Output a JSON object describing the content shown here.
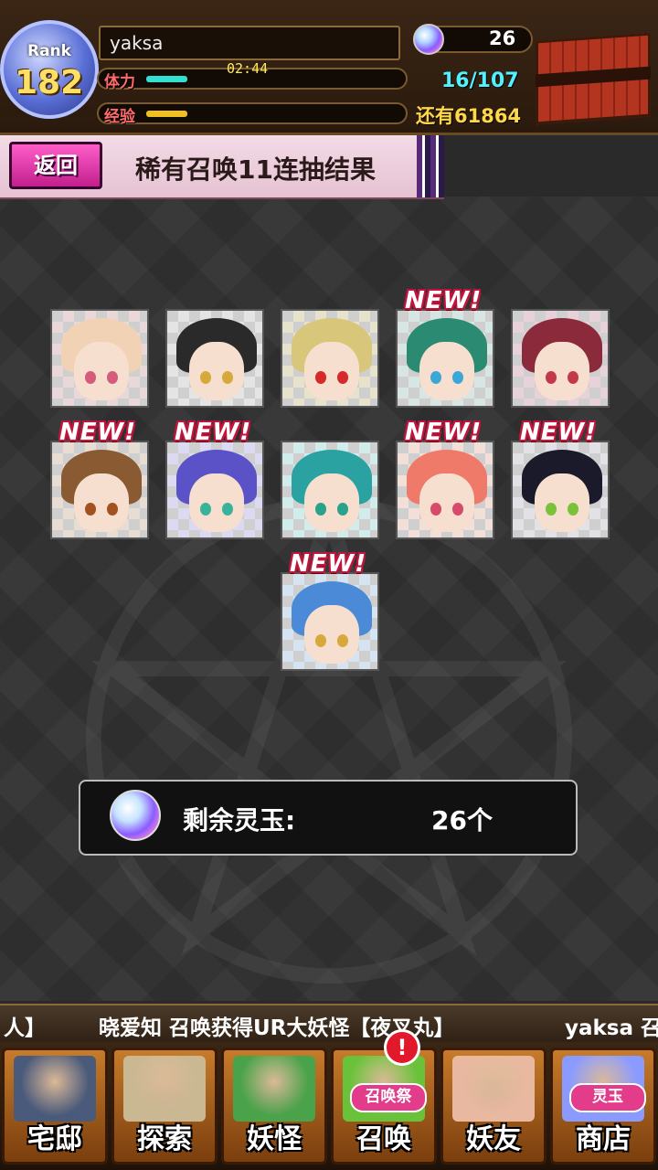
{
  "header": {
    "rank_label": "Rank",
    "rank_value": "182",
    "player_name": "yaksa",
    "stamina_label": "体力",
    "stamina_timer": "02:44",
    "stamina_fill": 0.16,
    "exp_label": "经验",
    "exp_fill": 0.16,
    "orb_count": "26",
    "stamina_count": "16/107",
    "exp_remaining": "还有61864"
  },
  "title_bar": {
    "back_label": "返回",
    "title": "稀有召唤11连抽结果"
  },
  "results": [
    {
      "new": false,
      "hair": "#f2d2b4",
      "bg": "#ead7da",
      "eye": "#d45b7a"
    },
    {
      "new": false,
      "hair": "#2a2a2a",
      "bg": "#e4e4e4",
      "eye": "#d6a93a"
    },
    {
      "new": false,
      "hair": "#d8c77a",
      "bg": "#e7e2cc",
      "eye": "#d62a2a"
    },
    {
      "new": true,
      "hair": "#2a8a72",
      "bg": "#d7e6e2",
      "eye": "#3aa7d6"
    },
    {
      "new": false,
      "hair": "#8a2a3a",
      "bg": "#e6d2d8",
      "eye": "#c23a4a"
    },
    {
      "new": true,
      "hair": "#8a5a32",
      "bg": "#e7ddd2",
      "eye": "#a2521e"
    },
    {
      "new": true,
      "hair": "#5a52c6",
      "bg": "#dcdaf2",
      "eye": "#3ab29a"
    },
    {
      "new": false,
      "hair": "#2aa2a2",
      "bg": "#d2ecec",
      "eye": "#2aa28a"
    },
    {
      "new": true,
      "hair": "#f07a6a",
      "bg": "#f2e0d8",
      "eye": "#d64a6a"
    },
    {
      "new": true,
      "hair": "#1a1a2a",
      "bg": "#e2e2e6",
      "eye": "#7ac23a"
    },
    {
      "new": true,
      "hair": "#4a8ad6",
      "bg": "#d6e4f2",
      "eye": "#d6a93a"
    }
  ],
  "new_label": "NEW!",
  "remaining": {
    "label": "剩余灵玉:",
    "value": "26个"
  },
  "ticker": {
    "segments": [
      "人】",
      "晓爱知 召唤获得UR大妖怪【夜叉丸】",
      "yaksa 召"
    ]
  },
  "nav": [
    {
      "label": "宅邸",
      "icon": "mansion-icon",
      "art": "#4a5a7a"
    },
    {
      "label": "探索",
      "icon": "magnifier-map-icon",
      "art": "#c9b892"
    },
    {
      "label": "妖怪",
      "icon": "scroll-icon",
      "art": "#4aa24a"
    },
    {
      "label": "召唤",
      "icon": "summon-star-icon",
      "art": "#6ac23a",
      "tag": "召唤祭",
      "badge": "!"
    },
    {
      "label": "妖友",
      "icon": "friend-girl-icon",
      "art": "#e9b8a0"
    },
    {
      "label": "商店",
      "icon": "spirit-orb-icon",
      "art": "#8a9aff",
      "tag": "灵玉"
    }
  ],
  "colors": {
    "stamina_fill": "#33e0d0",
    "exp_fill": "#f0c020",
    "back_button": "#e036a8",
    "new_outline": "#c0143c"
  }
}
